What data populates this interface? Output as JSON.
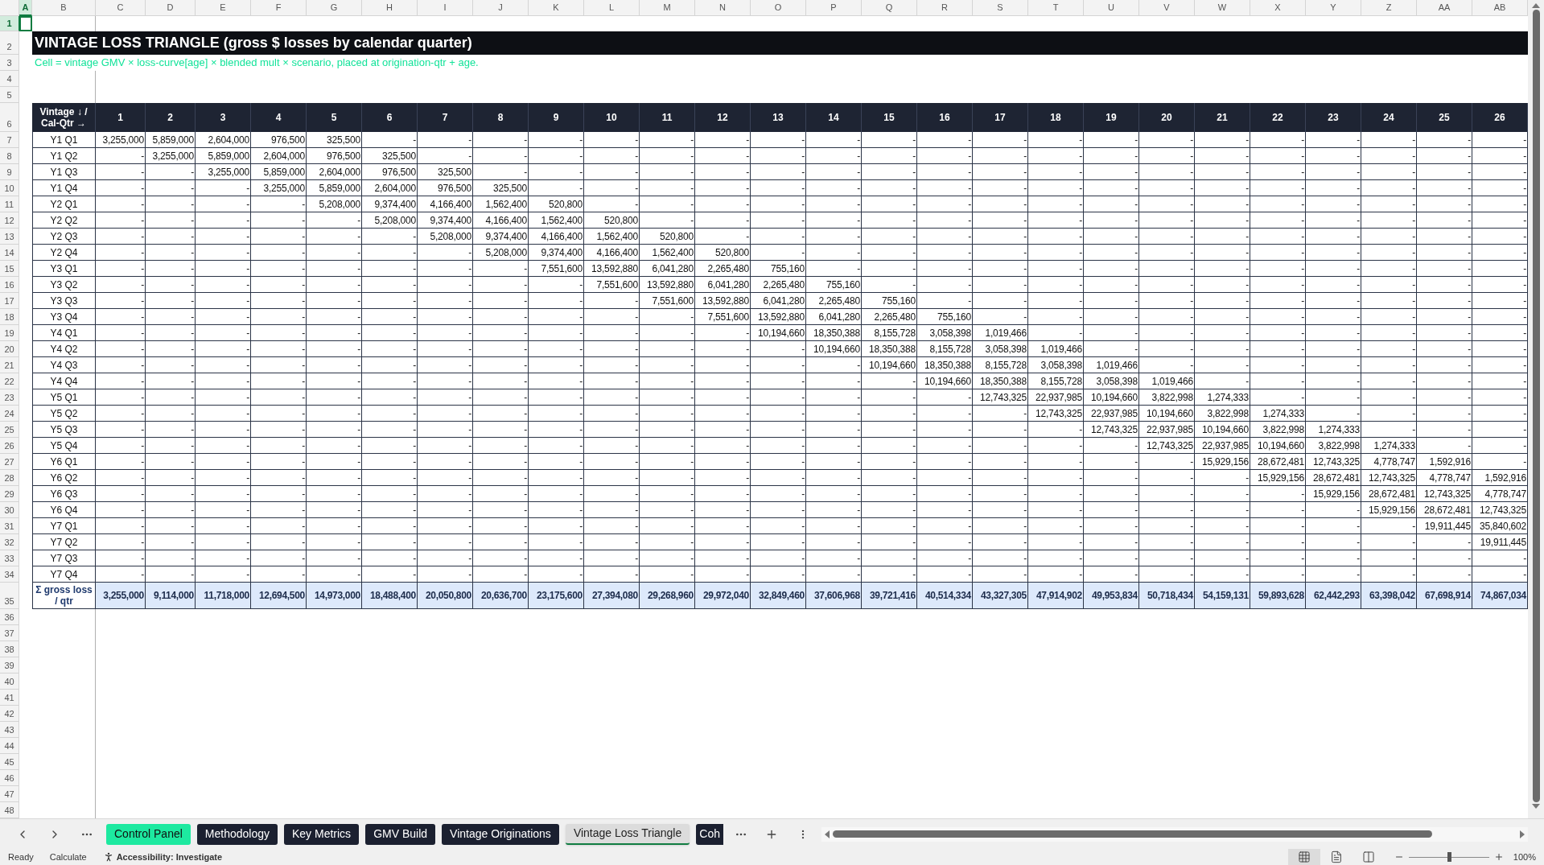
{
  "sheet": {
    "columns": [
      {
        "label": "A",
        "selected": true
      },
      {
        "label": "B",
        "selected": false
      },
      {
        "label": "C",
        "selected": false
      },
      {
        "label": "D",
        "selected": false
      },
      {
        "label": "E",
        "selected": false
      },
      {
        "label": "F",
        "selected": false
      },
      {
        "label": "G",
        "selected": false
      },
      {
        "label": "H",
        "selected": false
      },
      {
        "label": "I",
        "selected": false
      },
      {
        "label": "J",
        "selected": false
      },
      {
        "label": "K",
        "selected": false
      },
      {
        "label": "L",
        "selected": false
      },
      {
        "label": "M",
        "selected": false
      },
      {
        "label": "N",
        "selected": false
      },
      {
        "label": "O",
        "selected": false
      },
      {
        "label": "P",
        "selected": false
      },
      {
        "label": "Q",
        "selected": false
      },
      {
        "label": "R",
        "selected": false
      },
      {
        "label": "S",
        "selected": false
      },
      {
        "label": "T",
        "selected": false
      },
      {
        "label": "U",
        "selected": false
      },
      {
        "label": "V",
        "selected": false
      },
      {
        "label": "W",
        "selected": false
      },
      {
        "label": "X",
        "selected": false
      },
      {
        "label": "Y",
        "selected": false
      },
      {
        "label": "Z",
        "selected": false
      },
      {
        "label": "AA",
        "selected": false
      },
      {
        "label": "AB",
        "selected": false
      }
    ],
    "row_numbers": [
      {
        "label": "1",
        "selected": true
      },
      {
        "label": "2",
        "selected": false
      },
      {
        "label": "3",
        "selected": false
      },
      {
        "label": "4",
        "selected": false
      },
      {
        "label": "5",
        "selected": false
      },
      {
        "label": "6",
        "selected": false
      },
      {
        "label": "7",
        "selected": false
      },
      {
        "label": "8",
        "selected": false
      },
      {
        "label": "9",
        "selected": false
      },
      {
        "label": "10",
        "selected": false
      },
      {
        "label": "11",
        "selected": false
      },
      {
        "label": "12",
        "selected": false
      },
      {
        "label": "13",
        "selected": false
      },
      {
        "label": "14",
        "selected": false
      },
      {
        "label": "15",
        "selected": false
      },
      {
        "label": "16",
        "selected": false
      },
      {
        "label": "17",
        "selected": false
      },
      {
        "label": "18",
        "selected": false
      },
      {
        "label": "19",
        "selected": false
      },
      {
        "label": "20",
        "selected": false
      },
      {
        "label": "21",
        "selected": false
      },
      {
        "label": "22",
        "selected": false
      },
      {
        "label": "23",
        "selected": false
      },
      {
        "label": "24",
        "selected": false
      },
      {
        "label": "25",
        "selected": false
      },
      {
        "label": "26",
        "selected": false
      },
      {
        "label": "27",
        "selected": false
      },
      {
        "label": "28",
        "selected": false
      },
      {
        "label": "29",
        "selected": false
      },
      {
        "label": "30",
        "selected": false
      },
      {
        "label": "31",
        "selected": false
      },
      {
        "label": "32",
        "selected": false
      },
      {
        "label": "33",
        "selected": false
      },
      {
        "label": "34",
        "selected": false
      },
      {
        "label": "35",
        "selected": false
      },
      {
        "label": "36",
        "selected": false
      },
      {
        "label": "37",
        "selected": false
      },
      {
        "label": "38",
        "selected": false
      },
      {
        "label": "39",
        "selected": false
      },
      {
        "label": "40",
        "selected": false
      },
      {
        "label": "41",
        "selected": false
      },
      {
        "label": "42",
        "selected": false
      },
      {
        "label": "43",
        "selected": false
      },
      {
        "label": "44",
        "selected": false
      },
      {
        "label": "45",
        "selected": false
      },
      {
        "label": "46",
        "selected": false
      },
      {
        "label": "47",
        "selected": false
      },
      {
        "label": "48",
        "selected": false
      }
    ],
    "title": "VINTAGE LOSS TRIANGLE (gross $ losses by calendar quarter)",
    "subtitle": "Cell = vintage GMV × loss-curve[age] × blended mult × scenario, placed at origination-qtr + age.",
    "table": {
      "corner": "Vintage ↓ / Cal-Qtr →",
      "periods": [
        "1",
        "2",
        "3",
        "4",
        "5",
        "6",
        "7",
        "8",
        "9",
        "10",
        "11",
        "12",
        "13",
        "14",
        "15",
        "16",
        "17",
        "18",
        "19",
        "20",
        "21",
        "22",
        "23",
        "24",
        "25",
        "26"
      ],
      "rows": [
        {
          "vintage": "Y1 Q1",
          "cells": [
            "3,255,000",
            "5,859,000",
            "2,604,000",
            "976,500",
            "325,500",
            "-",
            "-",
            "-",
            "-",
            "-",
            "-",
            "-",
            "-",
            "-",
            "-",
            "-",
            "-",
            "-",
            "-",
            "-",
            "-",
            "-",
            "-",
            "-",
            "-",
            "-"
          ]
        },
        {
          "vintage": "Y1 Q2",
          "cells": [
            "-",
            "3,255,000",
            "5,859,000",
            "2,604,000",
            "976,500",
            "325,500",
            "-",
            "-",
            "-",
            "-",
            "-",
            "-",
            "-",
            "-",
            "-",
            "-",
            "-",
            "-",
            "-",
            "-",
            "-",
            "-",
            "-",
            "-",
            "-",
            "-"
          ]
        },
        {
          "vintage": "Y1 Q3",
          "cells": [
            "-",
            "-",
            "3,255,000",
            "5,859,000",
            "2,604,000",
            "976,500",
            "325,500",
            "-",
            "-",
            "-",
            "-",
            "-",
            "-",
            "-",
            "-",
            "-",
            "-",
            "-",
            "-",
            "-",
            "-",
            "-",
            "-",
            "-",
            "-",
            "-"
          ]
        },
        {
          "vintage": "Y1 Q4",
          "cells": [
            "-",
            "-",
            "-",
            "3,255,000",
            "5,859,000",
            "2,604,000",
            "976,500",
            "325,500",
            "-",
            "-",
            "-",
            "-",
            "-",
            "-",
            "-",
            "-",
            "-",
            "-",
            "-",
            "-",
            "-",
            "-",
            "-",
            "-",
            "-",
            "-"
          ]
        },
        {
          "vintage": "Y2 Q1",
          "cells": [
            "-",
            "-",
            "-",
            "-",
            "5,208,000",
            "9,374,400",
            "4,166,400",
            "1,562,400",
            "520,800",
            "-",
            "-",
            "-",
            "-",
            "-",
            "-",
            "-",
            "-",
            "-",
            "-",
            "-",
            "-",
            "-",
            "-",
            "-",
            "-",
            "-"
          ]
        },
        {
          "vintage": "Y2 Q2",
          "cells": [
            "-",
            "-",
            "-",
            "-",
            "-",
            "5,208,000",
            "9,374,400",
            "4,166,400",
            "1,562,400",
            "520,800",
            "-",
            "-",
            "-",
            "-",
            "-",
            "-",
            "-",
            "-",
            "-",
            "-",
            "-",
            "-",
            "-",
            "-",
            "-",
            "-"
          ]
        },
        {
          "vintage": "Y2 Q3",
          "cells": [
            "-",
            "-",
            "-",
            "-",
            "-",
            "-",
            "5,208,000",
            "9,374,400",
            "4,166,400",
            "1,562,400",
            "520,800",
            "-",
            "-",
            "-",
            "-",
            "-",
            "-",
            "-",
            "-",
            "-",
            "-",
            "-",
            "-",
            "-",
            "-",
            "-"
          ]
        },
        {
          "vintage": "Y2 Q4",
          "cells": [
            "-",
            "-",
            "-",
            "-",
            "-",
            "-",
            "-",
            "5,208,000",
            "9,374,400",
            "4,166,400",
            "1,562,400",
            "520,800",
            "-",
            "-",
            "-",
            "-",
            "-",
            "-",
            "-",
            "-",
            "-",
            "-",
            "-",
            "-",
            "-",
            "-"
          ]
        },
        {
          "vintage": "Y3 Q1",
          "cells": [
            "-",
            "-",
            "-",
            "-",
            "-",
            "-",
            "-",
            "-",
            "7,551,600",
            "13,592,880",
            "6,041,280",
            "2,265,480",
            "755,160",
            "-",
            "-",
            "-",
            "-",
            "-",
            "-",
            "-",
            "-",
            "-",
            "-",
            "-",
            "-",
            "-"
          ]
        },
        {
          "vintage": "Y3 Q2",
          "cells": [
            "-",
            "-",
            "-",
            "-",
            "-",
            "-",
            "-",
            "-",
            "-",
            "7,551,600",
            "13,592,880",
            "6,041,280",
            "2,265,480",
            "755,160",
            "-",
            "-",
            "-",
            "-",
            "-",
            "-",
            "-",
            "-",
            "-",
            "-",
            "-",
            "-"
          ]
        },
        {
          "vintage": "Y3 Q3",
          "cells": [
            "-",
            "-",
            "-",
            "-",
            "-",
            "-",
            "-",
            "-",
            "-",
            "-",
            "7,551,600",
            "13,592,880",
            "6,041,280",
            "2,265,480",
            "755,160",
            "-",
            "-",
            "-",
            "-",
            "-",
            "-",
            "-",
            "-",
            "-",
            "-",
            "-"
          ]
        },
        {
          "vintage": "Y3 Q4",
          "cells": [
            "-",
            "-",
            "-",
            "-",
            "-",
            "-",
            "-",
            "-",
            "-",
            "-",
            "-",
            "7,551,600",
            "13,592,880",
            "6,041,280",
            "2,265,480",
            "755,160",
            "-",
            "-",
            "-",
            "-",
            "-",
            "-",
            "-",
            "-",
            "-",
            "-"
          ]
        },
        {
          "vintage": "Y4 Q1",
          "cells": [
            "-",
            "-",
            "-",
            "-",
            "-",
            "-",
            "-",
            "-",
            "-",
            "-",
            "-",
            "-",
            "10,194,660",
            "18,350,388",
            "8,155,728",
            "3,058,398",
            "1,019,466",
            "-",
            "-",
            "-",
            "-",
            "-",
            "-",
            "-",
            "-",
            "-"
          ]
        },
        {
          "vintage": "Y4 Q2",
          "cells": [
            "-",
            "-",
            "-",
            "-",
            "-",
            "-",
            "-",
            "-",
            "-",
            "-",
            "-",
            "-",
            "-",
            "10,194,660",
            "18,350,388",
            "8,155,728",
            "3,058,398",
            "1,019,466",
            "-",
            "-",
            "-",
            "-",
            "-",
            "-",
            "-",
            "-"
          ]
        },
        {
          "vintage": "Y4 Q3",
          "cells": [
            "-",
            "-",
            "-",
            "-",
            "-",
            "-",
            "-",
            "-",
            "-",
            "-",
            "-",
            "-",
            "-",
            "-",
            "10,194,660",
            "18,350,388",
            "8,155,728",
            "3,058,398",
            "1,019,466",
            "-",
            "-",
            "-",
            "-",
            "-",
            "-",
            "-"
          ]
        },
        {
          "vintage": "Y4 Q4",
          "cells": [
            "-",
            "-",
            "-",
            "-",
            "-",
            "-",
            "-",
            "-",
            "-",
            "-",
            "-",
            "-",
            "-",
            "-",
            "-",
            "10,194,660",
            "18,350,388",
            "8,155,728",
            "3,058,398",
            "1,019,466",
            "-",
            "-",
            "-",
            "-",
            "-",
            "-"
          ]
        },
        {
          "vintage": "Y5 Q1",
          "cells": [
            "-",
            "-",
            "-",
            "-",
            "-",
            "-",
            "-",
            "-",
            "-",
            "-",
            "-",
            "-",
            "-",
            "-",
            "-",
            "-",
            "12,743,325",
            "22,937,985",
            "10,194,660",
            "3,822,998",
            "1,274,333",
            "-",
            "-",
            "-",
            "-",
            "-"
          ]
        },
        {
          "vintage": "Y5 Q2",
          "cells": [
            "-",
            "-",
            "-",
            "-",
            "-",
            "-",
            "-",
            "-",
            "-",
            "-",
            "-",
            "-",
            "-",
            "-",
            "-",
            "-",
            "-",
            "12,743,325",
            "22,937,985",
            "10,194,660",
            "3,822,998",
            "1,274,333",
            "-",
            "-",
            "-",
            "-"
          ]
        },
        {
          "vintage": "Y5 Q3",
          "cells": [
            "-",
            "-",
            "-",
            "-",
            "-",
            "-",
            "-",
            "-",
            "-",
            "-",
            "-",
            "-",
            "-",
            "-",
            "-",
            "-",
            "-",
            "-",
            "12,743,325",
            "22,937,985",
            "10,194,660",
            "3,822,998",
            "1,274,333",
            "-",
            "-",
            "-"
          ]
        },
        {
          "vintage": "Y5 Q4",
          "cells": [
            "-",
            "-",
            "-",
            "-",
            "-",
            "-",
            "-",
            "-",
            "-",
            "-",
            "-",
            "-",
            "-",
            "-",
            "-",
            "-",
            "-",
            "-",
            "-",
            "12,743,325",
            "22,937,985",
            "10,194,660",
            "3,822,998",
            "1,274,333",
            "-",
            "-"
          ]
        },
        {
          "vintage": "Y6 Q1",
          "cells": [
            "-",
            "-",
            "-",
            "-",
            "-",
            "-",
            "-",
            "-",
            "-",
            "-",
            "-",
            "-",
            "-",
            "-",
            "-",
            "-",
            "-",
            "-",
            "-",
            "-",
            "15,929,156",
            "28,672,481",
            "12,743,325",
            "4,778,747",
            "1,592,916",
            "-"
          ]
        },
        {
          "vintage": "Y6 Q2",
          "cells": [
            "-",
            "-",
            "-",
            "-",
            "-",
            "-",
            "-",
            "-",
            "-",
            "-",
            "-",
            "-",
            "-",
            "-",
            "-",
            "-",
            "-",
            "-",
            "-",
            "-",
            "-",
            "15,929,156",
            "28,672,481",
            "12,743,325",
            "4,778,747",
            "1,592,916"
          ]
        },
        {
          "vintage": "Y6 Q3",
          "cells": [
            "-",
            "-",
            "-",
            "-",
            "-",
            "-",
            "-",
            "-",
            "-",
            "-",
            "-",
            "-",
            "-",
            "-",
            "-",
            "-",
            "-",
            "-",
            "-",
            "-",
            "-",
            "-",
            "15,929,156",
            "28,672,481",
            "12,743,325",
            "4,778,747"
          ]
        },
        {
          "vintage": "Y6 Q4",
          "cells": [
            "-",
            "-",
            "-",
            "-",
            "-",
            "-",
            "-",
            "-",
            "-",
            "-",
            "-",
            "-",
            "-",
            "-",
            "-",
            "-",
            "-",
            "-",
            "-",
            "-",
            "-",
            "-",
            "-",
            "15,929,156",
            "28,672,481",
            "12,743,325"
          ]
        },
        {
          "vintage": "Y7 Q1",
          "cells": [
            "-",
            "-",
            "-",
            "-",
            "-",
            "-",
            "-",
            "-",
            "-",
            "-",
            "-",
            "-",
            "-",
            "-",
            "-",
            "-",
            "-",
            "-",
            "-",
            "-",
            "-",
            "-",
            "-",
            "-",
            "19,911,445",
            "35,840,602"
          ]
        },
        {
          "vintage": "Y7 Q2",
          "cells": [
            "-",
            "-",
            "-",
            "-",
            "-",
            "-",
            "-",
            "-",
            "-",
            "-",
            "-",
            "-",
            "-",
            "-",
            "-",
            "-",
            "-",
            "-",
            "-",
            "-",
            "-",
            "-",
            "-",
            "-",
            "-",
            "19,911,445"
          ]
        },
        {
          "vintage": "Y7 Q3",
          "cells": [
            "-",
            "-",
            "-",
            "-",
            "-",
            "-",
            "-",
            "-",
            "-",
            "-",
            "-",
            "-",
            "-",
            "-",
            "-",
            "-",
            "-",
            "-",
            "-",
            "-",
            "-",
            "-",
            "-",
            "-",
            "-",
            "-"
          ]
        },
        {
          "vintage": "Y7 Q4",
          "cells": [
            "-",
            "-",
            "-",
            "-",
            "-",
            "-",
            "-",
            "-",
            "-",
            "-",
            "-",
            "-",
            "-",
            "-",
            "-",
            "-",
            "-",
            "-",
            "-",
            "-",
            "-",
            "-",
            "-",
            "-",
            "-",
            "-"
          ]
        }
      ],
      "totals": {
        "label": "Σ gross loss / qtr",
        "cells": [
          "3,255,000",
          "9,114,000",
          "11,718,000",
          "12,694,500",
          "14,973,000",
          "18,488,400",
          "20,050,800",
          "20,636,700",
          "23,175,600",
          "27,394,080",
          "29,268,960",
          "29,972,040",
          "32,849,460",
          "37,606,968",
          "39,721,416",
          "40,514,334",
          "43,327,305",
          "47,914,902",
          "49,953,834",
          "50,718,434",
          "54,159,131",
          "59,893,628",
          "62,442,293",
          "63,398,042",
          "67,698,914",
          "74,867,034"
        ]
      }
    }
  },
  "tabs": [
    {
      "label": "Control Panel",
      "color": "#1de9a0",
      "selected": false
    },
    {
      "label": "Methodology",
      "color": "#1b2030",
      "selected": false
    },
    {
      "label": "Key Metrics",
      "color": "#1b2030",
      "selected": false
    },
    {
      "label": "GMV Build",
      "color": "#1b2030",
      "selected": false
    },
    {
      "label": "Vintage Originations",
      "color": "#1b2030",
      "selected": false
    },
    {
      "label": "Vintage Loss Triangle",
      "color": "#1b2030",
      "selected": true
    },
    {
      "label": "Coh",
      "color": "#1b2030",
      "selected": false
    }
  ],
  "status_bar": {
    "ready": "Ready",
    "calculate": "Calculate",
    "accessibility": "Accessibility: Investigate",
    "views": [
      {
        "kind": "normal",
        "selected": true
      },
      {
        "kind": "page-layout",
        "selected": false
      },
      {
        "kind": "page-break",
        "selected": false
      }
    ],
    "zoom": {
      "level": 0.5,
      "label": "100%"
    }
  }
}
